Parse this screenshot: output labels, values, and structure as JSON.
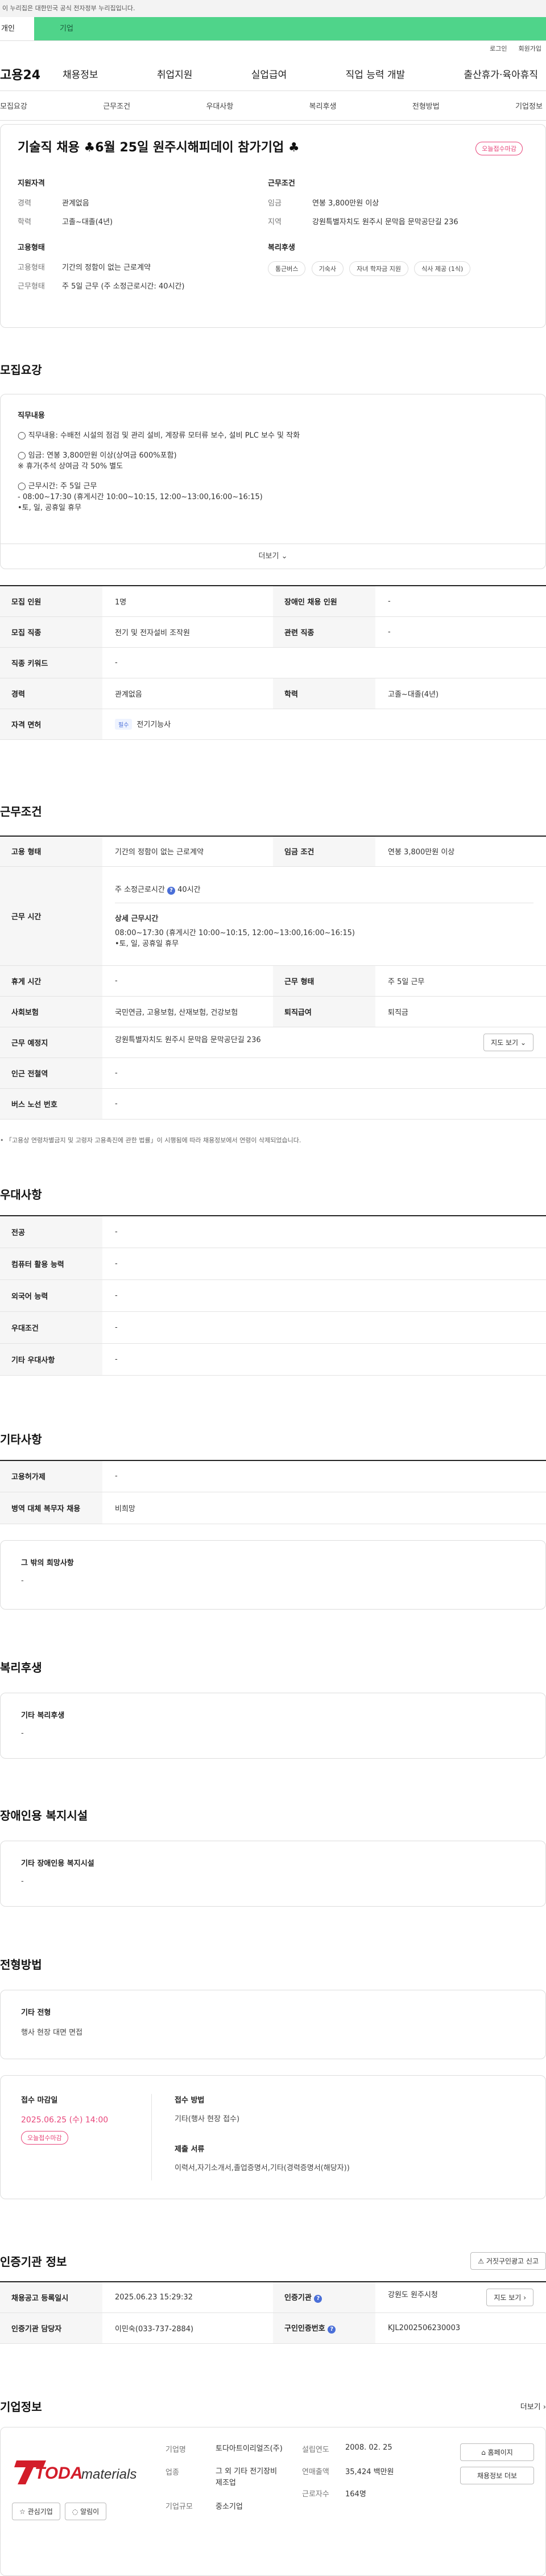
{
  "topbar": {
    "notice": "이 누리집은 대한민국 공식 전자정부 누리집입니다."
  },
  "tabs": {
    "personal": "개인",
    "company": "기업"
  },
  "util": {
    "login": "로그인",
    "signup": "회원가입"
  },
  "gnb": {
    "logo": "고용24",
    "items": [
      "채용정보",
      "취업지원",
      "실업급여",
      "직업 능력 개발",
      "출산휴가·육아휴직"
    ]
  },
  "snb": {
    "items": [
      "모집요강",
      "근무조건",
      "우대사항",
      "복리후생",
      "전형방법",
      "기업정보"
    ]
  },
  "headline": {
    "title": "기술직 채용 ♣6월 25일 원주시해피데이 참가기업 ♣",
    "badge": "오늘접수마감",
    "qualification": {
      "heading": "지원자격",
      "rows": [
        {
          "k": "경력",
          "v": "관계없음"
        },
        {
          "k": "학력",
          "v": "고졸~대졸(4년)"
        }
      ]
    },
    "employment": {
      "heading": "고용형태",
      "rows": [
        {
          "k": "고용형태",
          "v": "기간의 정함이 없는 근로계약"
        },
        {
          "k": "근무형태",
          "v": "주 5일 근무 (주 소정근로시간: 40시간)"
        }
      ]
    },
    "condition": {
      "heading": "근무조건",
      "rows": [
        {
          "k": "임금",
          "v": "연봉 3,800만원 이상"
        },
        {
          "k": "지역",
          "v": "강원특별자치도 원주시 문막읍 문막공단길 236"
        }
      ]
    },
    "welfare": {
      "heading": "복리후생",
      "chips": [
        "통근버스",
        "기숙사",
        "자녀 학자금 지원",
        "식사 제공 (1식)"
      ]
    }
  },
  "recruit": {
    "title": "모집요강",
    "desc_label": "직무내용",
    "lines": [
      "◯ 직무내용: 수배전 시설의 점검 및 관리 설비, 계장류 모터류 보수, 설비 PLC 보수 및 작화",
      "◯ 임금: 연봉 3,800만원 이상(상여금 600%포함)",
      "※ 휴가(추석 상여금 각 50% 별도",
      "◯ 근무시간: 주 5일 근무",
      "- 08:00~17:30 (휴게시간 10:00~10:15, 12:00~13:00,16:00~16:15)",
      "•토, 일, 공휴일 휴무"
    ],
    "more": "더보기",
    "table": {
      "headcount_k": "모집 인원",
      "headcount_v": "1명",
      "disabled_k": "장애인 채용 인원",
      "disabled_v": "-",
      "job_k": "모집 직종",
      "job_v": "전기 및 전자설비 조작원",
      "related_k": "관련 직종",
      "related_v": "-",
      "keyword_k": "직종 키워드",
      "keyword_v": "-",
      "career_k": "경력",
      "career_v": "관계없음",
      "edu_k": "학력",
      "edu_v": "고졸~대졸(4년)",
      "license_k": "자격 면허",
      "license_tag": "필수",
      "license_v": "전기기능사"
    }
  },
  "work": {
    "title": "근무조건",
    "type_k": "고용 형태",
    "type_v": "기간의 정함이 없는 근로계약",
    "wage_k": "임금 조건",
    "wage_v": "연봉 3,800만원 이상",
    "time_k": "근무 시간",
    "time_hours": "주 소정근로시간 ",
    "time_hours_v": " 40시간",
    "time_detail_label": "상세 근무시간",
    "time_detail": "08:00~17:30 (휴게시간 10:00~10:15, 12:00~13:00,16:00~16:15)",
    "time_holiday": "•토, 일, 공휴일 휴무",
    "break_k": "휴게 시간",
    "break_v": "-",
    "shape_k": "근무 형태",
    "shape_v": "주 5일 근무",
    "insurance_k": "사회보험",
    "insurance_v": "국민연금, 고용보험, 산재보험, 건강보험",
    "retire_k": "퇴직급여",
    "retire_v": "퇴직금",
    "place_k": "근무 예정지",
    "place_v": "강원특별자치도 원주시 문막읍 문막공단길 236",
    "map_btn": "지도 보기",
    "subway_k": "인근 전철역",
    "subway_v": "-",
    "bus_k": "버스 노선 번호",
    "bus_v": "-",
    "note": "「고용상 연령차별금지 및 고령자 고용촉진에 관한 법률」이 시행됨에 따라 채용정보에서 연령이 삭제되었습니다."
  },
  "preference": {
    "title": "우대사항",
    "rows": [
      {
        "k": "전공",
        "v": "-"
      },
      {
        "k": "컴퓨터 활용 능력",
        "v": "-"
      },
      {
        "k": "외국어 능력",
        "v": "-"
      },
      {
        "k": "우대조건",
        "v": "-"
      },
      {
        "k": "기타 우대사항",
        "v": "-"
      }
    ]
  },
  "etc": {
    "title": "기타사항",
    "rows": [
      {
        "k": "고용허가제",
        "v": "-"
      },
      {
        "k": "병역 대체 복무자 채용",
        "v": "비희망"
      }
    ],
    "box_label": "그 밖의 희망사항",
    "box_v": "-"
  },
  "benefit": {
    "title": "복리후생",
    "box_label": "기타 복리후생",
    "box_v": "-"
  },
  "disabled": {
    "title": "장애인용 복지시설",
    "box_label": "기타 장애인용 복지시설",
    "box_v": "-"
  },
  "screening": {
    "title": "전형방법",
    "method_label": "기타 전형",
    "method_v": "행사 현장 대면 면접",
    "deadline_label": "접수 마감일",
    "deadline_v": "2025.06.25 (수) 14:00",
    "deadline_badge": "오늘접수마감",
    "apply_label": "접수 방법",
    "apply_v": "기타(행사 현장 접수)",
    "docs_label": "제출 서류",
    "docs_v": "이력서,자기소개서,졸업증명서,기타(경력증명서(해당자))"
  },
  "cert": {
    "title": "인증기관 정보",
    "report_btn": "거짓구인광고 신고",
    "reg_k": "채용공고 등록일시",
    "reg_v": "2025.06.23 15:29:32",
    "agency_k": "인증기관",
    "agency_v": "강원도 원주시청",
    "map_btn": "지도 보기",
    "manager_k": "인증기관 담당자",
    "manager_v": "이민숙(033-737-2884)",
    "no_k": "구인인증번호",
    "no_v": "KJL2002506230003"
  },
  "company": {
    "title": "기업정보",
    "more": "더보기",
    "logo_text": "TODA",
    "logo_sub": "materials",
    "fav_btn": "관심기업",
    "alert_btn": "알림이",
    "name_k": "기업명",
    "name_v": "토다아트이리얼즈(주)",
    "industry_k": "업종",
    "industry_v": "그 외 기타 전기장비 제조업",
    "size_k": "기업규모",
    "size_v": "중소기업",
    "founded_k": "설립연도",
    "founded_v": "2008. 02. 25",
    "sales_k": "연매출액",
    "sales_v": "35,424 백만원",
    "emp_k": "근로자수",
    "emp_v": "164명",
    "home_btn": "홈페이지",
    "jobs_btn": "채용정보 더보"
  }
}
